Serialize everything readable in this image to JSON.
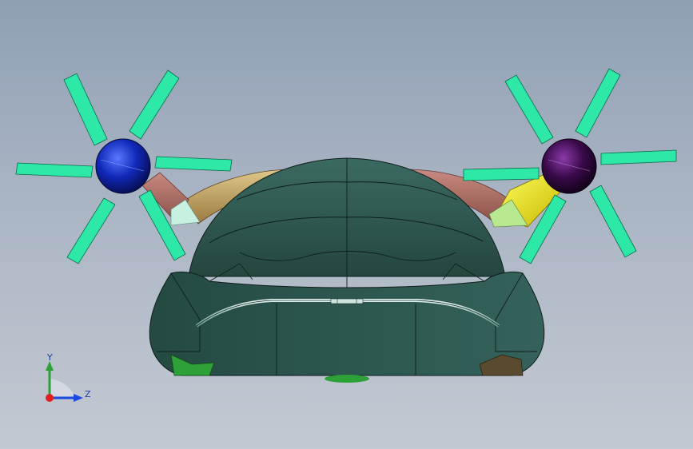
{
  "triad": {
    "y_label": "Y",
    "z_label": "Z"
  },
  "colors": {
    "background_top": "#8f9fb4",
    "background_bottom": "#c3c9d2",
    "body": "#2f5a52",
    "blade": "#2ee8a8",
    "left_hub": "#1028b8",
    "right_hub": "#3a0a4a",
    "arm_tan": "#c8a86a",
    "arm_pink": "#e8a898",
    "arm_yellow": "#e8e020"
  }
}
